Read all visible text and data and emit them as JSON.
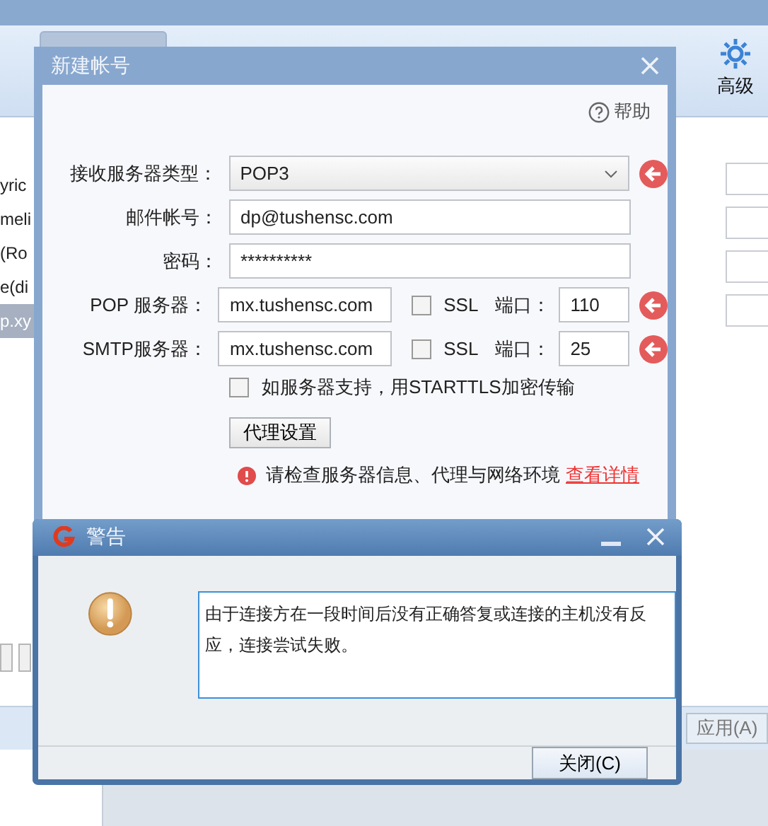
{
  "background_window": {
    "toolbar": {
      "advanced_label": "高级"
    },
    "list_items": [
      {
        "label": "yric",
        "selected": false
      },
      {
        "label": "meli",
        "selected": false
      },
      {
        "label": "(Ro",
        "selected": false
      },
      {
        "label": "e(di",
        "selected": false
      },
      {
        "label": "p.xy",
        "selected": true
      }
    ],
    "apply_button": "应用(A)"
  },
  "account_dialog": {
    "title": "新建帐号",
    "help": "帮助",
    "rows": [
      {
        "kind": "select",
        "label": "接收服务器类型：",
        "value": "POP3",
        "flagged": true
      },
      {
        "kind": "text",
        "label": "邮件帐号：",
        "value": "dp@tushensc.com",
        "flagged": false
      },
      {
        "kind": "text",
        "label": "密码：",
        "value": "**********",
        "flagged": false
      },
      {
        "kind": "server",
        "label": "POP 服务器：",
        "value": "mx.tushensc.com",
        "ssl_label": "SSL",
        "ssl_checked": false,
        "port_label": "端口：",
        "port": "110",
        "flagged": true
      },
      {
        "kind": "server",
        "label": "SMTP服务器：",
        "value": "mx.tushensc.com",
        "ssl_label": "SSL",
        "ssl_checked": false,
        "port_label": "端口：",
        "port": "25",
        "flagged": true
      }
    ],
    "starttls": {
      "label": "如服务器支持，用STARTTLS加密传输",
      "checked": false
    },
    "proxy_button": "代理设置",
    "error": {
      "message": "请检查服务器信息、代理与网络环境",
      "link": "查看详情"
    }
  },
  "alert": {
    "title": "警告",
    "message": "由于连接方在一段时间后没有正确答复或连接的主机没有反应，连接尝试失败。",
    "close_button": "关闭(C)"
  }
}
